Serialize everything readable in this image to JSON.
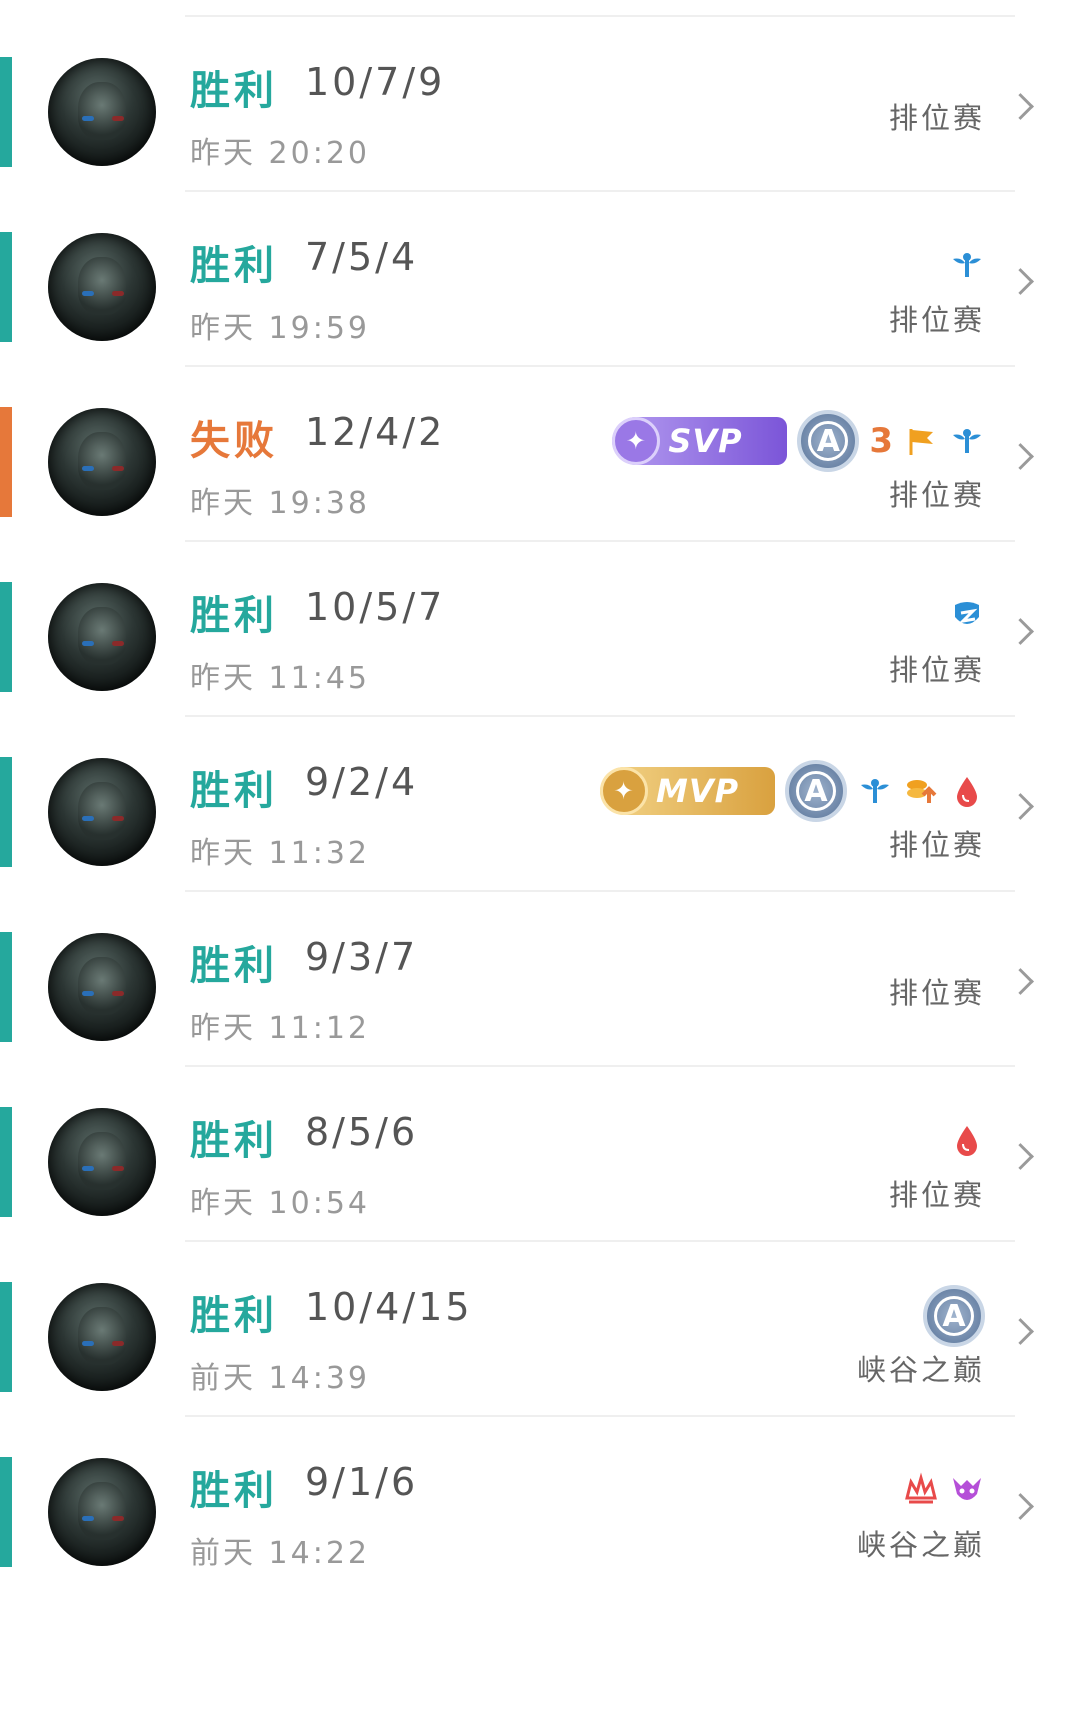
{
  "colors": {
    "win": "#25a89d",
    "loss": "#e6783a"
  },
  "matches": [
    {
      "result": "胜利",
      "outcome": "win",
      "kda": "10/7/9",
      "time": "昨天 20:20",
      "mode": "排位赛",
      "badges": []
    },
    {
      "result": "胜利",
      "outcome": "win",
      "kda": "7/5/4",
      "time": "昨天 19:59",
      "mode": "排位赛",
      "badges": [
        {
          "type": "icon",
          "name": "wings-icon"
        }
      ]
    },
    {
      "result": "失败",
      "outcome": "loss",
      "kda": "12/4/2",
      "time": "昨天 19:38",
      "mode": "排位赛",
      "badges": [
        {
          "type": "svp",
          "label": "SVP"
        },
        {
          "type": "grade",
          "label": "A"
        },
        {
          "type": "number",
          "label": "3"
        },
        {
          "type": "icon",
          "name": "flag-icon"
        },
        {
          "type": "icon",
          "name": "wings-icon"
        }
      ]
    },
    {
      "result": "胜利",
      "outcome": "win",
      "kda": "10/5/7",
      "time": "昨天 11:45",
      "mode": "排位赛",
      "badges": [
        {
          "type": "icon",
          "name": "shield-icon"
        }
      ]
    },
    {
      "result": "胜利",
      "outcome": "win",
      "kda": "9/2/4",
      "time": "昨天 11:32",
      "mode": "排位赛",
      "badges": [
        {
          "type": "mvp",
          "label": "MVP"
        },
        {
          "type": "grade",
          "label": "A"
        },
        {
          "type": "icon",
          "name": "wings-icon"
        },
        {
          "type": "icon",
          "name": "coins-icon"
        },
        {
          "type": "icon",
          "name": "blood-drop-icon"
        }
      ]
    },
    {
      "result": "胜利",
      "outcome": "win",
      "kda": "9/3/7",
      "time": "昨天 11:12",
      "mode": "排位赛",
      "badges": []
    },
    {
      "result": "胜利",
      "outcome": "win",
      "kda": "8/5/6",
      "time": "昨天 10:54",
      "mode": "排位赛",
      "badges": [
        {
          "type": "icon",
          "name": "blood-drop-icon"
        }
      ]
    },
    {
      "result": "胜利",
      "outcome": "win",
      "kda": "10/4/15",
      "time": "前天 14:39",
      "mode": "峡谷之巅",
      "badges": [
        {
          "type": "grade",
          "label": "A"
        }
      ]
    },
    {
      "result": "胜利",
      "outcome": "win",
      "kda": "9/1/6",
      "time": "前天 14:22",
      "mode": "峡谷之巅",
      "badges": [
        {
          "type": "icon",
          "name": "crown-icon"
        },
        {
          "type": "icon",
          "name": "demon-icon"
        }
      ]
    }
  ]
}
